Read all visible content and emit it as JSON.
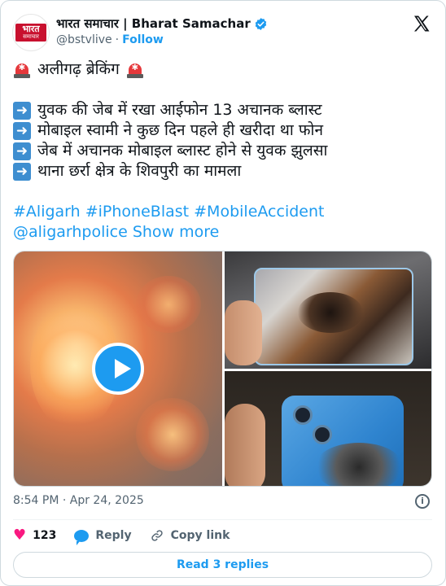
{
  "account": {
    "avatar_text_top": "भारत",
    "avatar_text_bottom": "समाचार",
    "display_name": "भारत समाचार | Bharat Samachar",
    "handle": "@bstvlive",
    "separator": "·",
    "follow_label": "Follow",
    "verified_color": "#1d9bf0"
  },
  "tweet": {
    "headline": "अलीगढ़ ब्रेकिंग",
    "bullets": [
      "युवक की जेब में रखा आईफोन 13 अचानक ब्लास्ट",
      "मोबाइल स्वामी ने कुछ दिन पहले ही खरीदा था फोन",
      "जेब में अचानक मोबाइल ब्लास्ट होने से युवक झुलसा",
      "थाना छर्रा क्षेत्र के शिवपुरी का मामला"
    ],
    "hashtags": "#Aligarh #iPhoneBlast #MobileAccident",
    "mention": "@aligarhpolice",
    "show_more": "Show more"
  },
  "meta": {
    "timestamp": "8:54 PM · Apr 24, 2025",
    "info_glyph": "i"
  },
  "actions": {
    "likes_count": "123",
    "reply_label": "Reply",
    "copy_link_label": "Copy link"
  },
  "footer": {
    "read_replies": "Read 3 replies"
  },
  "icons": {
    "siren": "siren-icon",
    "arrow": "right-arrow-icon",
    "x_logo": "x-logo-icon",
    "play": "play-icon"
  },
  "colors": {
    "accent": "#1d9bf0",
    "like": "#f91880",
    "text": "#0f1419",
    "secondary": "#536471"
  }
}
